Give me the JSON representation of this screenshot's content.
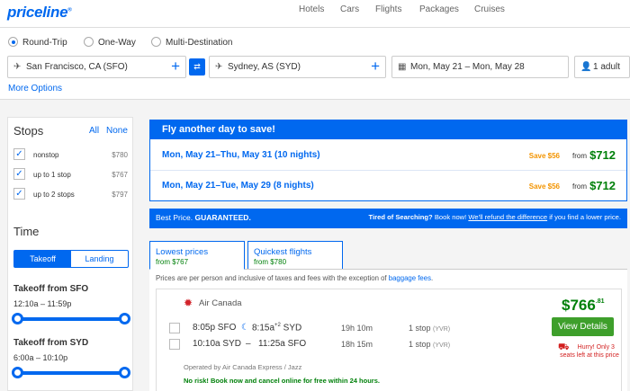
{
  "header": {
    "logo": "priceline",
    "logo_mark": "®",
    "nav": [
      "Hotels",
      "Cars",
      "Flights",
      "Packages",
      "Cruises"
    ]
  },
  "search": {
    "trip_types": [
      "Round-Trip",
      "One-Way",
      "Multi-Destination"
    ],
    "selected_trip_type": "Round-Trip",
    "origin": "San Francisco, CA (SFO)",
    "destination": "Sydney, AS (SYD)",
    "dates": "Mon, May 21 – Mon, May 28",
    "travelers": "1 adult",
    "more_options": "More Options",
    "plus_glyph": "+",
    "swap_glyph": "⇄",
    "plane_glyph": "✈",
    "calendar_glyph": "▦",
    "person_glyph": "👤"
  },
  "filters": {
    "stops_title": "Stops",
    "all": "All",
    "none": "None",
    "stops": [
      {
        "label": "nonstop",
        "price": "$780",
        "checked": true
      },
      {
        "label": "up to 1 stop",
        "price": "$767",
        "checked": true
      },
      {
        "label": "up to 2 stops",
        "price": "$797",
        "checked": true
      }
    ],
    "check_glyph": "✓",
    "time_title": "Time",
    "takeoff_tab": "Takeoff",
    "landing_tab": "Landing",
    "ranges": [
      {
        "title": "Takeoff from SFO",
        "from": "12:10a",
        "to": "11:59p"
      },
      {
        "title": "Takeoff from SYD",
        "from": "6:00a",
        "to": "10:10p"
      }
    ]
  },
  "promo": {
    "title": "Fly another day to save!",
    "rows": [
      {
        "dates": "Mon, May 21–Thu, May 31 (10 nights)",
        "save": "Save $56",
        "from": "from",
        "price": "$712"
      },
      {
        "dates": "Mon, May 21–Tue, May 29 (8 nights)",
        "save": "Save $56",
        "from": "from",
        "price": "$712"
      }
    ]
  },
  "guarantee": {
    "left_prefix": "Best Price. ",
    "left_bold": "GUARANTEED.",
    "right_bold": "Tired of Searching?",
    "right_text": " Book now! ",
    "right_link": "We'll refund the difference",
    "right_suffix": " if you find a lower price."
  },
  "tabs": [
    {
      "title": "Lowest prices",
      "sub": "from $767"
    },
    {
      "title": "Quickest flights",
      "sub": "from $780"
    }
  ],
  "disclaimer": {
    "text": "Prices are per person and inclusive of taxes and fees with the exception of ",
    "link": "baggage fees",
    "end": "."
  },
  "result": {
    "airline": "Air Canada",
    "leaf_glyph": "✹",
    "legs": [
      {
        "depart": "8:05p SFO",
        "moon": "☾",
        "arrive": "8:15a",
        "plus": "+2",
        "arrive_code": "SYD",
        "duration": "19h 10m",
        "stops": "1 stop",
        "via": "(YVR)"
      },
      {
        "depart": "10:10a SYD",
        "dash": "–",
        "arrive": "11:25a SFO",
        "duration": "18h 15m",
        "stops": "1 stop",
        "via": "(YVR)"
      }
    ],
    "operated": "Operated by Air Canada Express / Jazz",
    "no_risk": "No risk! Book now and cancel online for free within 24 hours.",
    "price": "$766",
    "cents": ".81",
    "view_details": "View Details",
    "seat_glyph": "⛟",
    "hurry": "Hurry! Only 3 seats left at this price"
  },
  "colors": {
    "brand_blue": "#0068ef",
    "price_green": "#00800a",
    "save_orange": "#f39400",
    "cta_green": "#3e9f2b",
    "warning_red": "#d21f1f"
  }
}
